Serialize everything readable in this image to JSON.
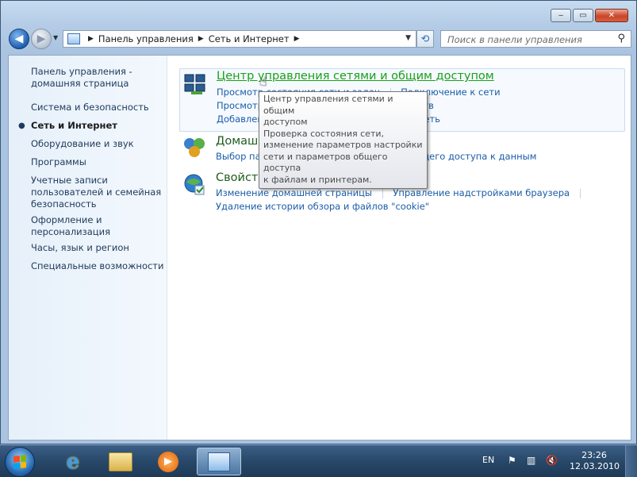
{
  "window": {
    "caption_buttons": {
      "minimize": "‒",
      "maximize": "▭",
      "close": "✕"
    }
  },
  "nav": {
    "back_icon": "arrow-left-icon",
    "forward_icon": "arrow-right-icon",
    "breadcrumb": [
      "Панель управления",
      "Сеть и Интернет"
    ],
    "search_placeholder": "Поиск в панели управления"
  },
  "sidebar": {
    "home": "Панель управления - домашняя страница",
    "items": [
      {
        "label": "Система и безопасность"
      },
      {
        "label": "Сеть и Интернет",
        "current": true
      },
      {
        "label": "Оборудование и звук"
      },
      {
        "label": "Программы"
      },
      {
        "label": "Учетные записи пользователей и семейная безопасность"
      },
      {
        "label": "Оформление и персонализация"
      },
      {
        "label": "Часы, язык и регион"
      },
      {
        "label": "Специальные возможности"
      }
    ]
  },
  "categories": {
    "network_center": {
      "title": "Центр управления сетями и общим доступом",
      "links": [
        "Просмотр состояния сети и задач",
        "Подключение к сети",
        "Просмотр сетевых компьютеров и устройств",
        "Добавление беспроводного устройства в сеть"
      ]
    },
    "homegroup": {
      "title": "Домашняя группа",
      "links": [
        "Выбор параметров домашней группы и общего доступа к данным"
      ]
    },
    "internet_options": {
      "title": "Свойства обозревателя",
      "links": [
        "Изменение домашней страницы",
        "Управление надстройками браузера",
        "Удаление истории обзора и файлов \"cookie\""
      ]
    }
  },
  "tooltip": "Центр управления сетями и общим доступом Проверка состояния сети, изменение параметров настройки сети и параметров общего доступа к файлам и принтерам.",
  "tooltip_lines": [
    "Центр управления сетями и общим",
    "доступом",
    "Проверка состояния сети,",
    "изменение параметров настройки",
    "сети и параметров общего доступа",
    "к файлам и принтерам."
  ],
  "taskbar": {
    "language": "EN",
    "time": "23:26",
    "date": "12.03.2010"
  },
  "colors": {
    "link": "#1a5ca8",
    "category_title": "#1e5c1e",
    "sidebar_text": "#1e395b"
  }
}
